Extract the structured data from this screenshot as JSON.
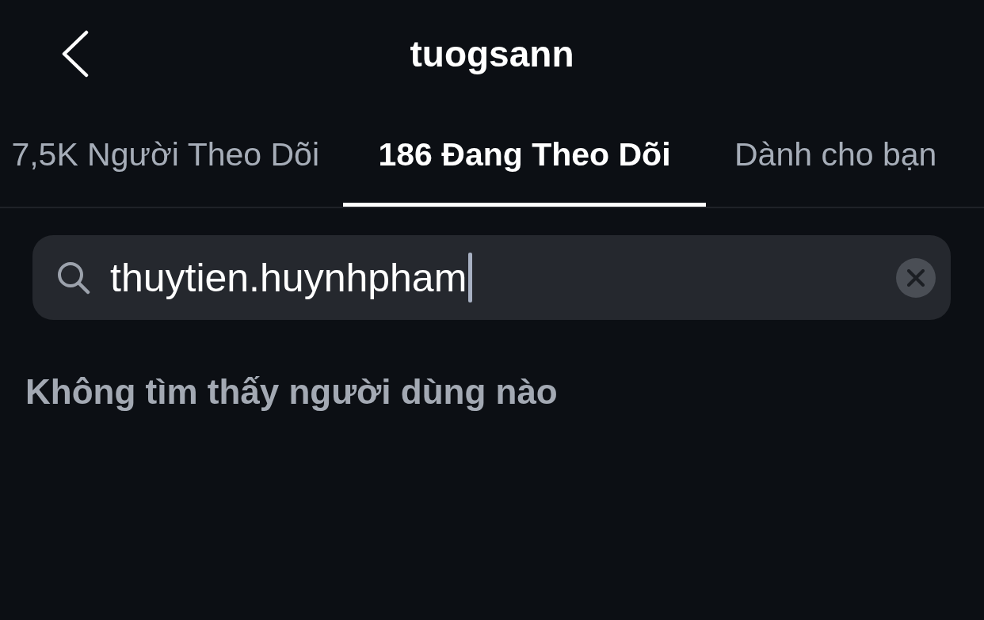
{
  "header": {
    "title": "tuogsann"
  },
  "tabs": [
    {
      "label": "7,5K Người Theo Dõi",
      "selected": false
    },
    {
      "label": "186 Đang Theo Dõi",
      "selected": true
    },
    {
      "label": "Dành cho bạn",
      "selected": false
    }
  ],
  "search": {
    "value": "thuytien.huynhpham"
  },
  "message": "Không tìm thấy người dùng nào"
}
